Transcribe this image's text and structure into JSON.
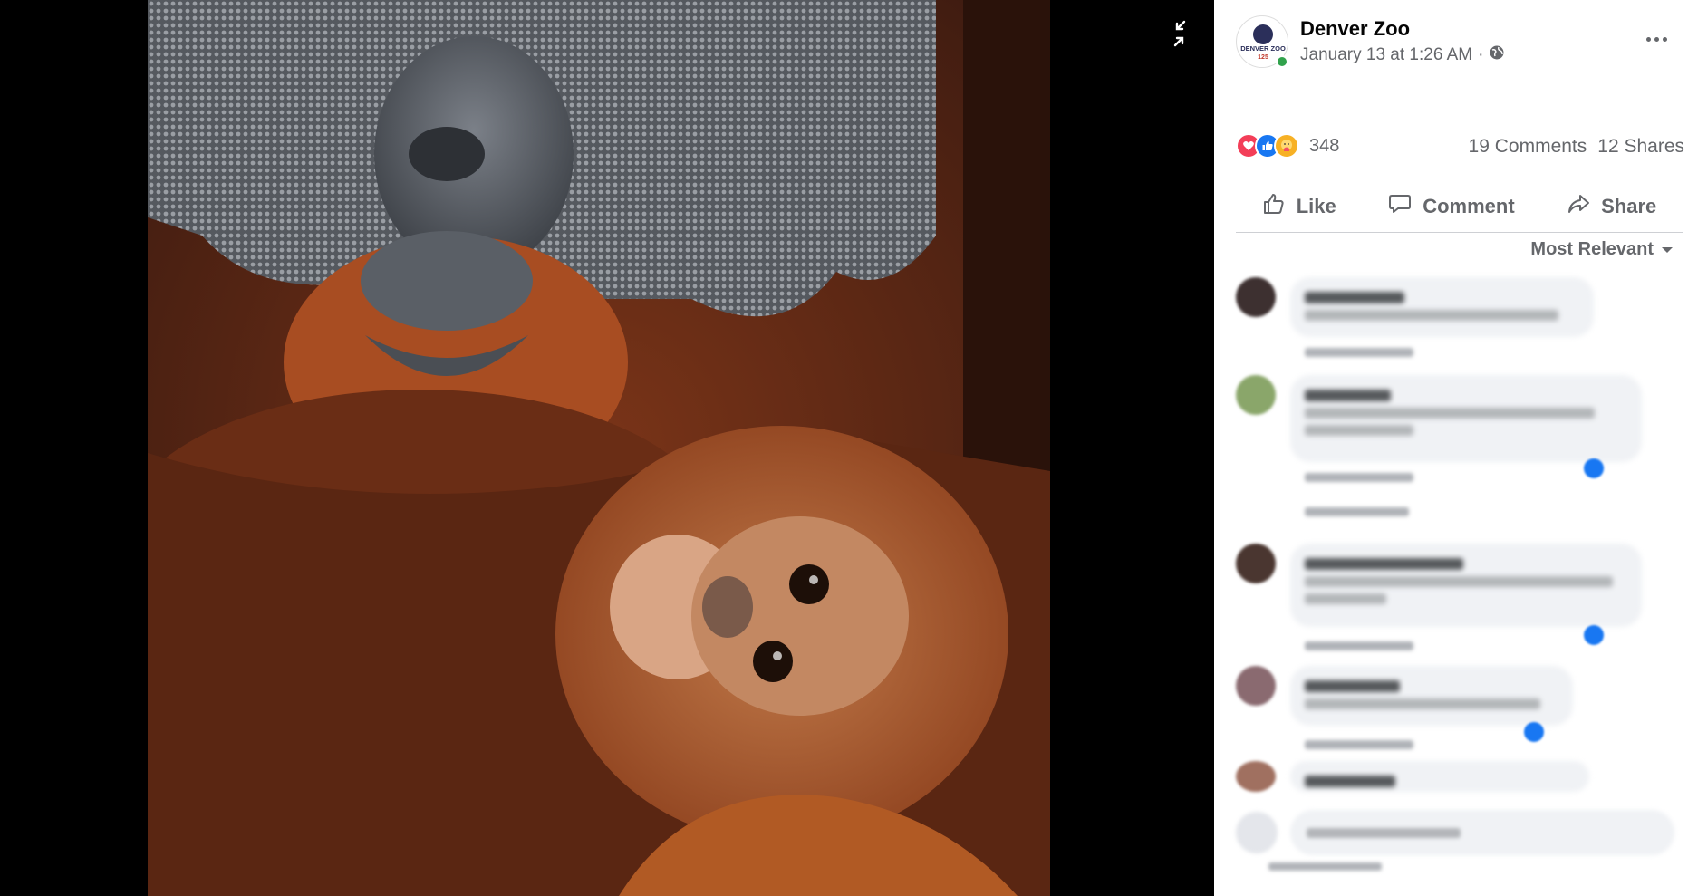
{
  "post": {
    "page_name": "Denver Zoo",
    "timestamp": "January 13 at 1:26 AM",
    "separator": "·",
    "audience_icon": "globe-icon",
    "avatar_text_top": "DENVER ZOO",
    "avatar_text_bottom": "125"
  },
  "engagement": {
    "reaction_icons": [
      "love-icon",
      "like-icon",
      "care-icon"
    ],
    "reaction_count": "348",
    "comments": "19 Comments",
    "shares": "12 Shares"
  },
  "actions": {
    "like": "Like",
    "comment": "Comment",
    "share": "Share"
  },
  "comments_section": {
    "sort_label": "Most Relevant"
  },
  "colors": {
    "viewer_bg": "#000000",
    "accent": "#1877f2",
    "secondary_text": "#65676b",
    "bubble_bg": "#f0f2f5"
  }
}
